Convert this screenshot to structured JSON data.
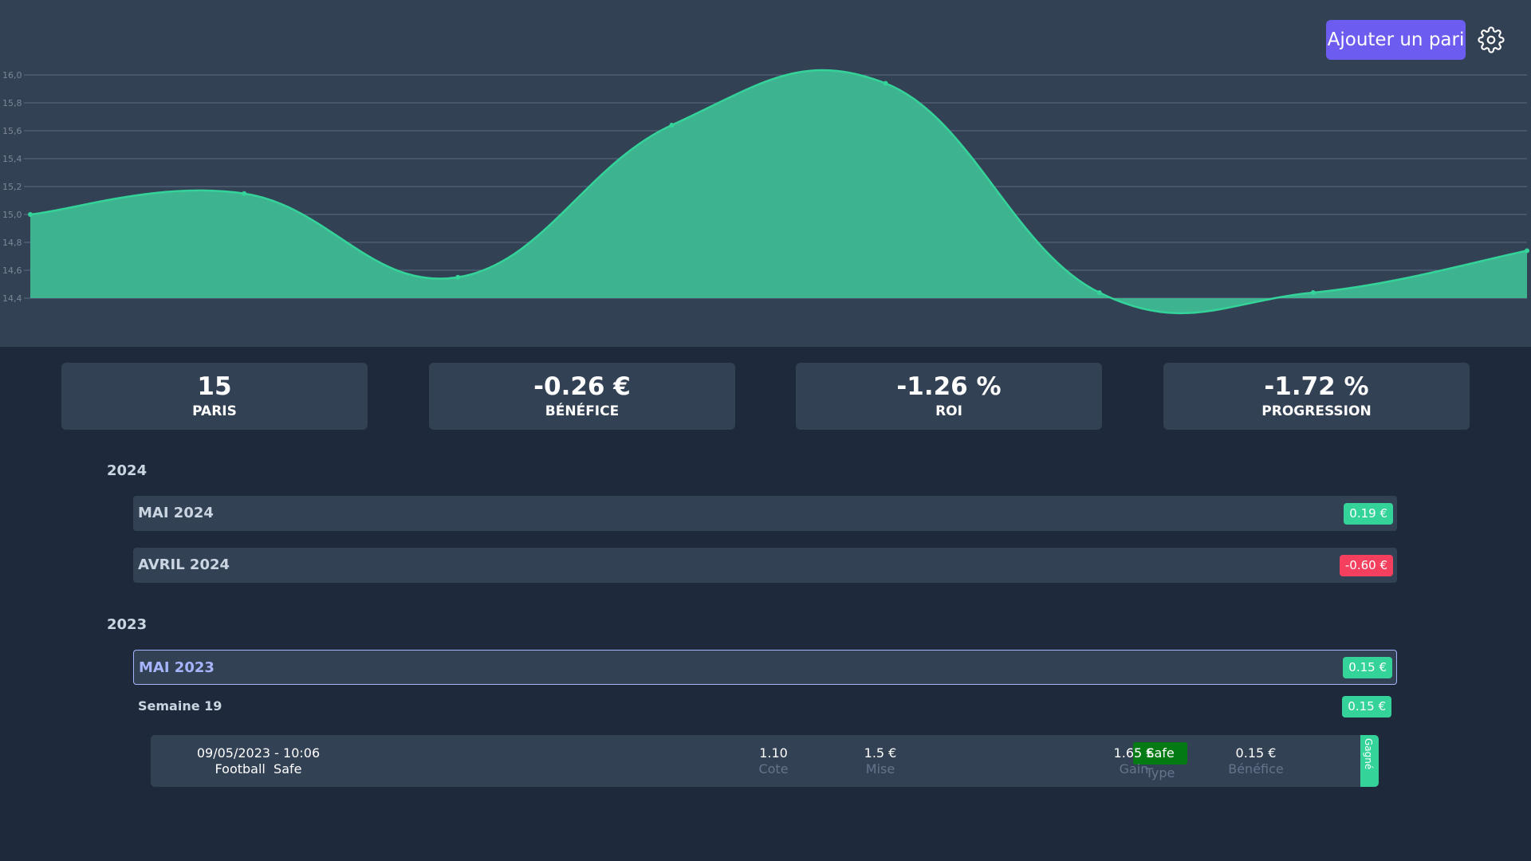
{
  "header": {
    "add_bet_label": "Ajouter un pari",
    "settings_icon": "gear-icon"
  },
  "chart_data": {
    "type": "area",
    "x": [
      1,
      2,
      3,
      4,
      5,
      6,
      7,
      8
    ],
    "series": [
      {
        "values": [
          15.0,
          15.15,
          14.55,
          15.64,
          15.94,
          14.44,
          14.44,
          14.74
        ]
      }
    ],
    "ylim": [
      14.4,
      16.0
    ],
    "yticks": [
      "16,0",
      "15,8",
      "15,6",
      "15,4",
      "15,2",
      "15,0",
      "14,8",
      "14,6",
      "14,4"
    ],
    "grid": true,
    "fill_color": "#3eb38f",
    "line_color": "#34d399"
  },
  "stats": [
    {
      "value": "15",
      "label": "PARIS"
    },
    {
      "value": "-0.26 €",
      "label": "BÉNÉFICE"
    },
    {
      "value": "-1.26 %",
      "label": "ROI"
    },
    {
      "value": "-1.72 %",
      "label": "PROGRESSION"
    }
  ],
  "years": [
    {
      "year": "2024",
      "months": [
        {
          "label": "MAI 2024",
          "badge": "0.19 €",
          "status": "positive"
        },
        {
          "label": "AVRIL 2024",
          "badge": "-0.60 €",
          "status": "negative"
        }
      ]
    },
    {
      "year": "2023",
      "months": [
        {
          "label": "MAI 2023",
          "badge": "0.15 €",
          "status": "positive"
        }
      ]
    }
  ],
  "week": {
    "label": "Semaine 19",
    "badge": "0.15 €"
  },
  "bet": {
    "datetime": "09/05/2023 - 10:06",
    "sport": "Football",
    "category": "Safe",
    "odds_value": "1.10",
    "odds_label": "Cote",
    "stake_value": "1.5 €",
    "stake_label": "Mise",
    "type_value": "Safe",
    "type_label": "Type",
    "gain_value": "1.65 €",
    "gain_label": "Gain",
    "profit_value": "0.15 €",
    "profit_label": "Bénéfice",
    "status": "Gagné"
  },
  "colors": {
    "positive": "#34d399",
    "negative": "#f43f5e",
    "accent": "#6d5cf0",
    "safe_badge": "#047a15"
  }
}
